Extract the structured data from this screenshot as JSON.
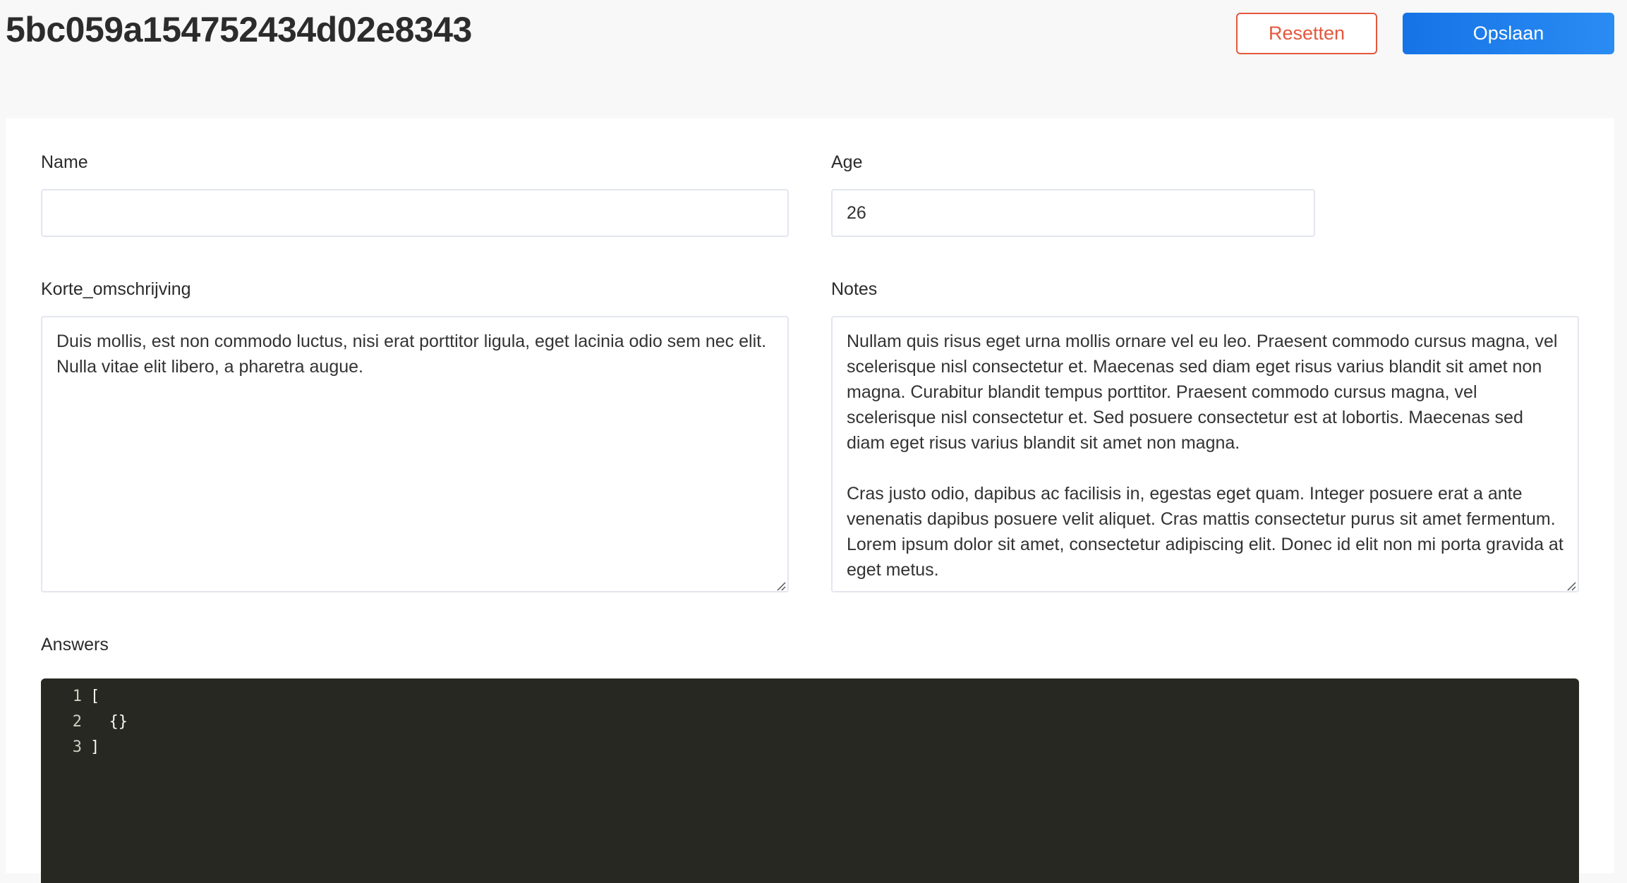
{
  "header": {
    "title": "5bc059a154752434d02e8343",
    "reset_label": "Resetten",
    "save_label": "Opslaan"
  },
  "form": {
    "name": {
      "label": "Name",
      "value": ""
    },
    "age": {
      "label": "Age",
      "value": "26"
    },
    "korte_omschrijving": {
      "label": "Korte_omschrijving",
      "value": "Duis mollis, est non commodo luctus, nisi erat porttitor ligula, eget lacinia odio sem nec elit. Nulla vitae elit libero, a pharetra augue."
    },
    "notes": {
      "label": "Notes",
      "value": "Nullam quis risus eget urna mollis ornare vel eu leo. Praesent commodo cursus magna, vel scelerisque nisl consectetur et. Maecenas sed diam eget risus varius blandit sit amet non magna. Curabitur blandit tempus porttitor. Praesent commodo cursus magna, vel scelerisque nisl consectetur et. Sed posuere consectetur est at lobortis. Maecenas sed diam eget risus varius blandit sit amet non magna.\n\nCras justo odio, dapibus ac facilisis in, egestas eget quam. Integer posuere erat a ante venenatis dapibus posuere velit aliquet. Cras mattis consectetur purus sit amet fermentum. Lorem ipsum dolor sit amet, consectetur adipiscing elit. Donec id elit non mi porta gravida at eget metus."
    },
    "answers": {
      "label": "Answers",
      "lines": [
        {
          "num": "1",
          "code": "["
        },
        {
          "num": "2",
          "code": "  {}"
        },
        {
          "num": "3",
          "code": "]"
        }
      ]
    }
  },
  "colors": {
    "reset_border": "#e4573d",
    "save_bg": "#1673e6",
    "editor_bg": "#272822",
    "page_bg": "#f8f8f8"
  }
}
